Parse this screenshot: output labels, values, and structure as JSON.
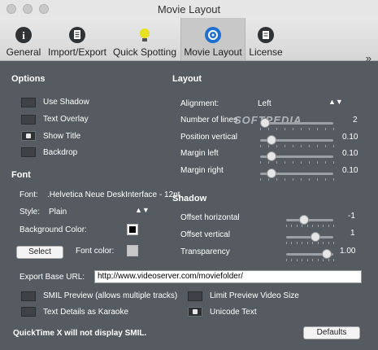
{
  "window": {
    "title": "Movie Layout"
  },
  "toolbar": {
    "tabs": [
      {
        "label": "General",
        "icon": "info-icon"
      },
      {
        "label": "Import/Export",
        "icon": "document-icon"
      },
      {
        "label": "Quick Spotting",
        "icon": "lightbulb-icon"
      },
      {
        "label": "Movie Layout",
        "icon": "movie-icon"
      },
      {
        "label": "License",
        "icon": "license-icon"
      }
    ],
    "active_tab": "Movie Layout",
    "overflow": "»"
  },
  "options": {
    "heading": "Options",
    "items": [
      {
        "label": "Use Shadow",
        "checked": false
      },
      {
        "label": "Text Overlay",
        "checked": false
      },
      {
        "label": "Show Title",
        "checked": true
      },
      {
        "label": "Backdrop",
        "checked": false
      }
    ]
  },
  "layout": {
    "heading": "Layout",
    "alignment_label": "Alignment:",
    "alignment_value": "Left",
    "rows": [
      {
        "label": "Number of lines",
        "value": "2",
        "level": 0.0
      },
      {
        "label": "Position vertical",
        "value": "0.10",
        "level": 0.1
      },
      {
        "label": "Margin left",
        "value": "0.10",
        "level": 0.1
      },
      {
        "label": "Margin right",
        "value": "0.10",
        "level": 0.1
      }
    ]
  },
  "font": {
    "heading": "Font",
    "font_label": "Font:",
    "font_value": ".Helvetica Neue DeskInterface - 12pt",
    "style_label": "Style:",
    "style_value": "Plain",
    "bg_label": "Background Color:",
    "select_label": "Select",
    "font_color_label": "Font color:"
  },
  "shadow": {
    "heading": "Shadow",
    "rows": [
      {
        "label": "Offset horizontal",
        "value": "-1",
        "level": 0.35
      },
      {
        "label": "Offset vertical",
        "value": "1",
        "level": 0.65
      },
      {
        "label": "Transparency",
        "value": "1.00",
        "level": 0.95
      }
    ]
  },
  "export": {
    "base_url_label": "Export Base URL:",
    "base_url_value": "http://www.videoserver.com/moviefolder/",
    "checks": [
      {
        "label": "SMIL Preview (allows multiple tracks)",
        "checked": false
      },
      {
        "label": "Limit Preview Video Size",
        "checked": false
      },
      {
        "label": "Text Details as Karaoke",
        "checked": false
      },
      {
        "label": "Unicode Text",
        "checked": true
      }
    ]
  },
  "footer": {
    "warning": "QuickTime X will not display SMIL.",
    "defaults_label": "Defaults"
  },
  "watermark": "SOFTPEDIA"
}
